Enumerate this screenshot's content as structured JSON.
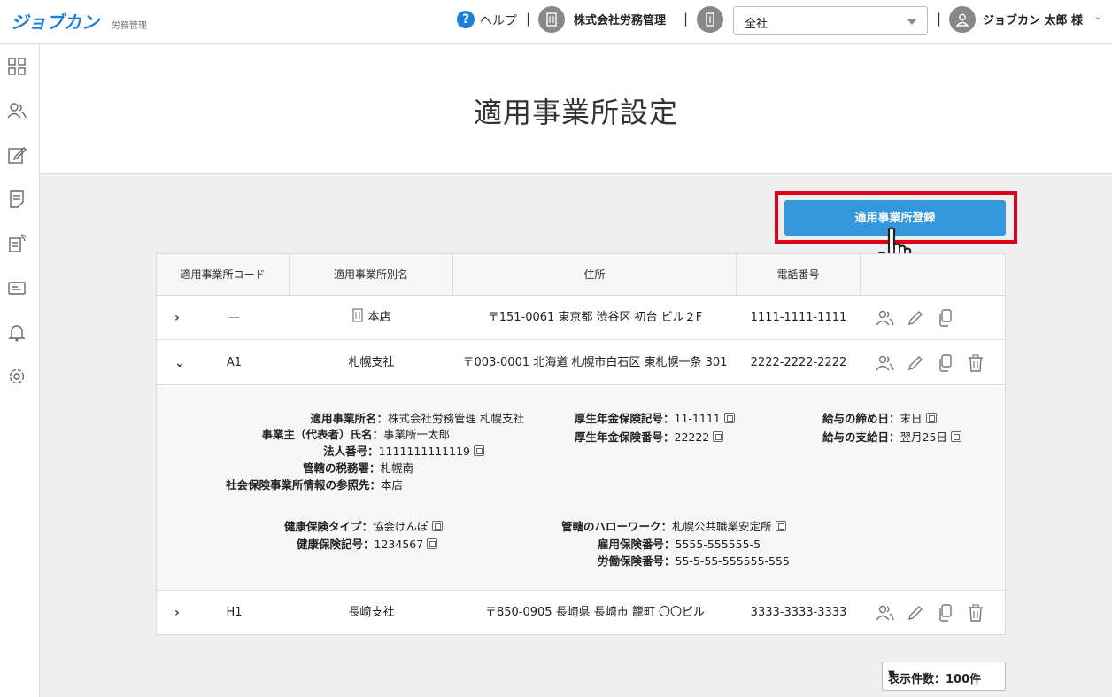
{
  "header": {
    "logo": "ジョブカン",
    "logo_sub": "労務管理",
    "help": "ヘルプ",
    "separator": "|",
    "company": "株式会社労務管理",
    "office_select": "全社",
    "user": "ジョブカン 太郎 様"
  },
  "page": {
    "title": "適用事業所設定",
    "register_button": "適用事業所登録"
  },
  "table": {
    "columns": [
      "適用事業所コード",
      "適用事業所別名",
      "住所",
      "電話番号",
      ""
    ],
    "rows": [
      {
        "expand": "›",
        "code": "—",
        "name": "本店",
        "address": "〒151-0061 東京都 渋谷区 初台 ビル２F",
        "phone": "1111-1111-1111"
      },
      {
        "expand": "⌄",
        "code": "A1",
        "name": "札幌支社",
        "address": "〒003-0001 北海道 札幌市白石区 東札幌一条 301",
        "phone": "2222-2222-2222"
      },
      {
        "expand": "›",
        "code": "H1",
        "name": "長崎支社",
        "address": "〒850-0905 長崎県 長崎市 籠町 〇〇ビル",
        "phone": "3333-3333-3333"
      }
    ]
  },
  "detail": {
    "office_name_k": "適用事業所名：",
    "office_name_v": "株式会社労務管理 札幌支社",
    "owner_k": "事業主（代表者）氏名：",
    "owner_v": "事業所一太郎",
    "corp_no_k": "法人番号：",
    "corp_no_v": "1111111111119",
    "tax_office_k": "管轄の税務署：",
    "tax_office_v": "札幌南",
    "ref_k": "社会保険事業所情報の参照先：",
    "ref_v": "本店",
    "pension_sym_k": "厚生年金保険記号：",
    "pension_sym_v": "11-1111",
    "pension_no_k": "厚生年金保険番号：",
    "pension_no_v": "22222",
    "closing_k": "給与の締め日：",
    "closing_v": "末日",
    "payday_k": "給与の支給日：",
    "payday_v": "翌月25日",
    "health_type_k": "健康保険タイプ：",
    "health_type_v": "協会けんぽ",
    "health_sym_k": "健康保険記号：",
    "health_sym_v": "1234567",
    "hello_k": "管轄のハローワーク：",
    "hello_v": "札幌公共職業安定所",
    "emp_ins_k": "雇用保険番号：",
    "emp_ins_v": "5555-555555-5",
    "labor_ins_k": "労働保険番号：",
    "labor_ins_v": "55-5-55-555555-555"
  },
  "pagination": {
    "per_page": "表示件数：100件",
    "caret": "▼"
  }
}
